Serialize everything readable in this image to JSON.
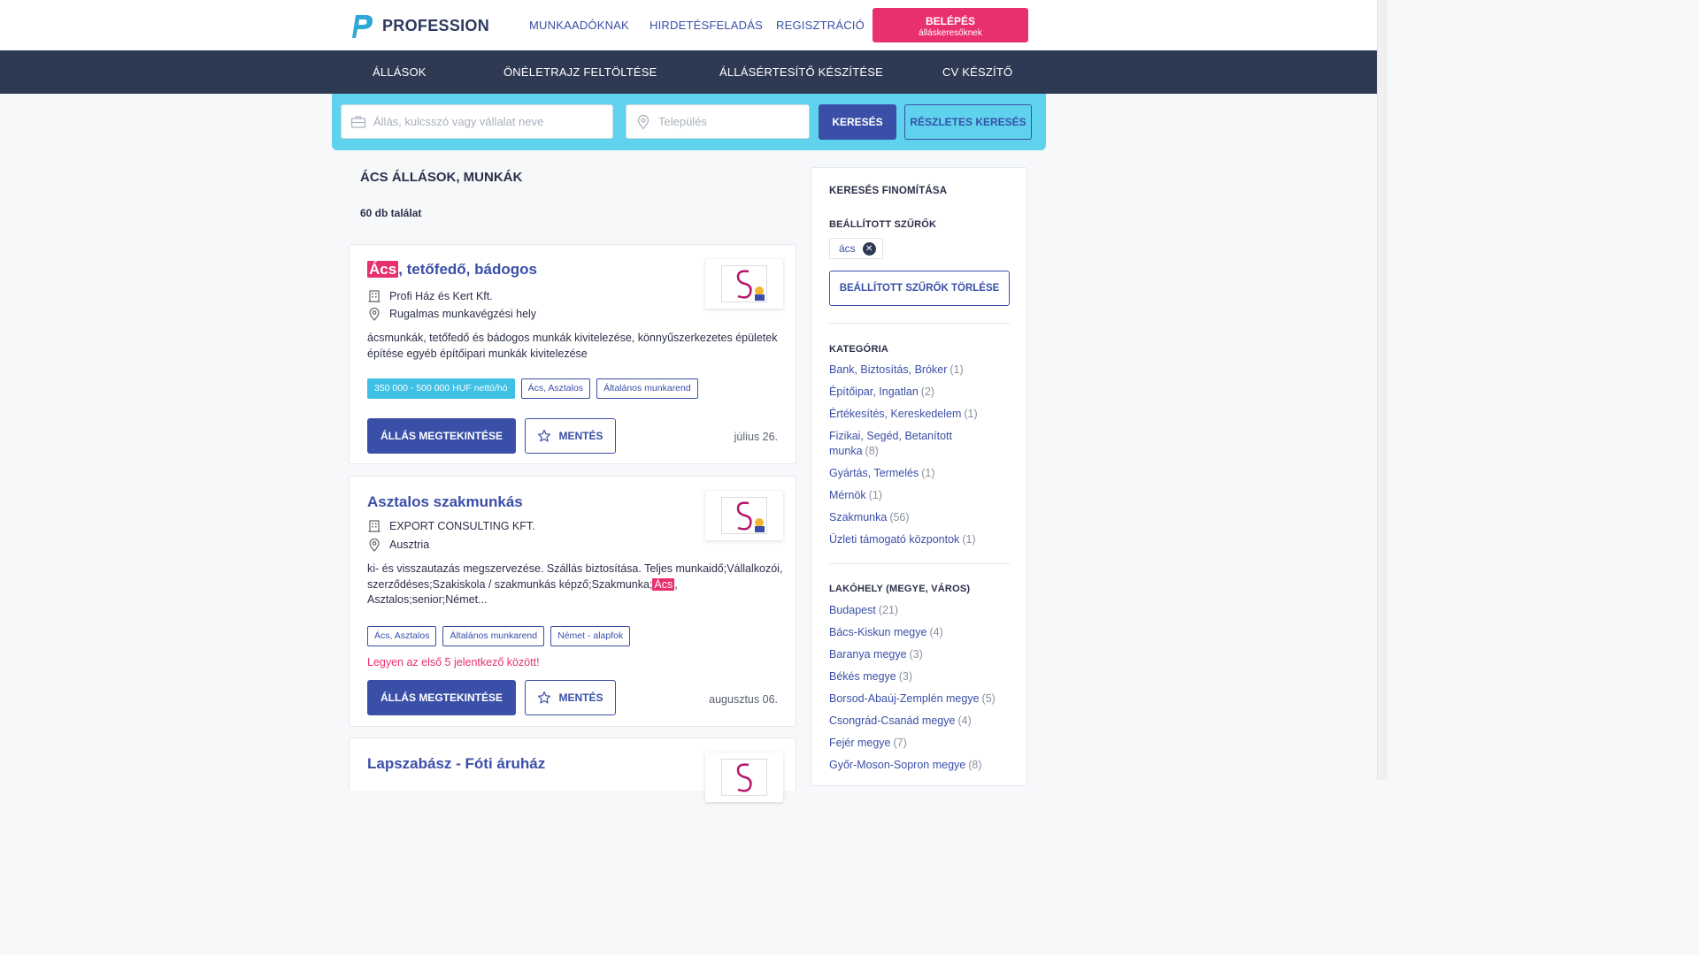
{
  "header": {
    "logo_text": "PROFESSION",
    "nav": [
      "MUNKAADÓKNAK",
      "HIRDETÉSFELADÁS",
      "REGISZTRÁCIÓ"
    ],
    "login": {
      "label": "BELÉPÉS",
      "sublabel": "álláskeresőknek"
    }
  },
  "mainnav": [
    "ÁLLÁSOK",
    "ÖNÉLETRAJZ FELTÖLTÉSE",
    "ÁLLÁSÉRTESÍTŐ KÉSZÍTÉSE",
    "CV KÉSZÍTŐ"
  ],
  "search": {
    "keyword_placeholder": "Állás, kulcsszó vagy vállalat neve",
    "location_placeholder": "Település",
    "search_label": "KERESÉS",
    "advanced_label": "RÉSZLETES KERESÉS"
  },
  "results": {
    "title": "ÁCS ÁLLÁSOK, MUNKÁK",
    "count": "60 db találat"
  },
  "jobs": [
    {
      "title_highlight": "Ács",
      "title_rest": ", tetőfedő, bádogos",
      "company": "Profi Ház és Kert Kft.",
      "location": "Rugalmas munkavégzési hely",
      "description": "ácsmunkák, tetőfedő és bádogos munkák kivitelezése, könnyűszerkezetes épületek építése egyéb építőipari munkák kivitelezése",
      "tags": [
        "350 000 - 500 000 HUF nettó/hó",
        "Ács, Asztalos",
        "Általános munkarend"
      ],
      "view_label": "ÁLLÁS MEGTEKINTÉSE",
      "save_label": "MENTÉS",
      "date": "július 26."
    },
    {
      "title": "Asztalos szakmunkás",
      "company": "EXPORT CONSULTING KFT.",
      "location": "Ausztria",
      "description_part1": "ki- és visszautazás megszervezése. Szállás biztosítása. Teljes munkaidő;Vállalkozói, szerződéses;Szakiskola / szakmunkás képző;Szakmunka;",
      "description_highlight": "Ács",
      "description_part2": ", Asztalos;senior;Német...",
      "tags": [
        "Ács, Asztalos",
        "Általános munkarend",
        "Német - alapfok"
      ],
      "promo": "Legyen az első 5 jelentkező között!",
      "view_label": "ÁLLÁS MEGTEKINTÉSE",
      "save_label": "MENTÉS",
      "date": "augusztus 06."
    },
    {
      "title": "Lapszabász - Fóti áruház"
    }
  ],
  "sidebar": {
    "title": "KERESÉS FINOMÍTÁSA",
    "filters_heading": "BEÁLLÍTOTT SZŰRŐK",
    "active_filter": "ács",
    "clear_label": "BEÁLLÍTOTT SZŰRŐK TÖRLÉSE",
    "category_heading": "KATEGÓRIA",
    "categories": [
      {
        "name": "Bank, Biztosítás, Bróker",
        "count": "(1)"
      },
      {
        "name": "Építőipar, Ingatlan",
        "count": "(2)"
      },
      {
        "name": "Értékesítés, Kereskedelem",
        "count": "(1)"
      },
      {
        "name": "Fizikai, Segéd, Betanított munka",
        "count": "(8)"
      },
      {
        "name": "Gyártás, Termelés",
        "count": "(1)"
      },
      {
        "name": "Mérnök",
        "count": "(1)"
      },
      {
        "name": "Szakmunka",
        "count": "(56)"
      },
      {
        "name": "Üzleti támogató központok",
        "count": "(1)"
      }
    ],
    "location_heading": "LAKÓHELY (MEGYE, VÁROS)",
    "locations": [
      {
        "name": "Budapest",
        "count": "(21)"
      },
      {
        "name": "Bács-Kiskun megye",
        "count": "(4)"
      },
      {
        "name": "Baranya megye",
        "count": "(3)"
      },
      {
        "name": "Békés megye",
        "count": "(3)"
      },
      {
        "name": "Borsod-Abaúj-Zemplén megye",
        "count": "(5)"
      },
      {
        "name": "Csongrád-Csanád megye",
        "count": "(4)"
      },
      {
        "name": "Fejér megye",
        "count": "(7)"
      },
      {
        "name": "Győr-Moson-Sopron megye",
        "count": "(8)"
      }
    ]
  },
  "colors": {
    "primary": "#3a4fa8",
    "accent": "#e8306c",
    "nav_bg": "#2e3a54",
    "search_band": "#5fd3ee",
    "salary_tag": "#3fc1e6"
  }
}
